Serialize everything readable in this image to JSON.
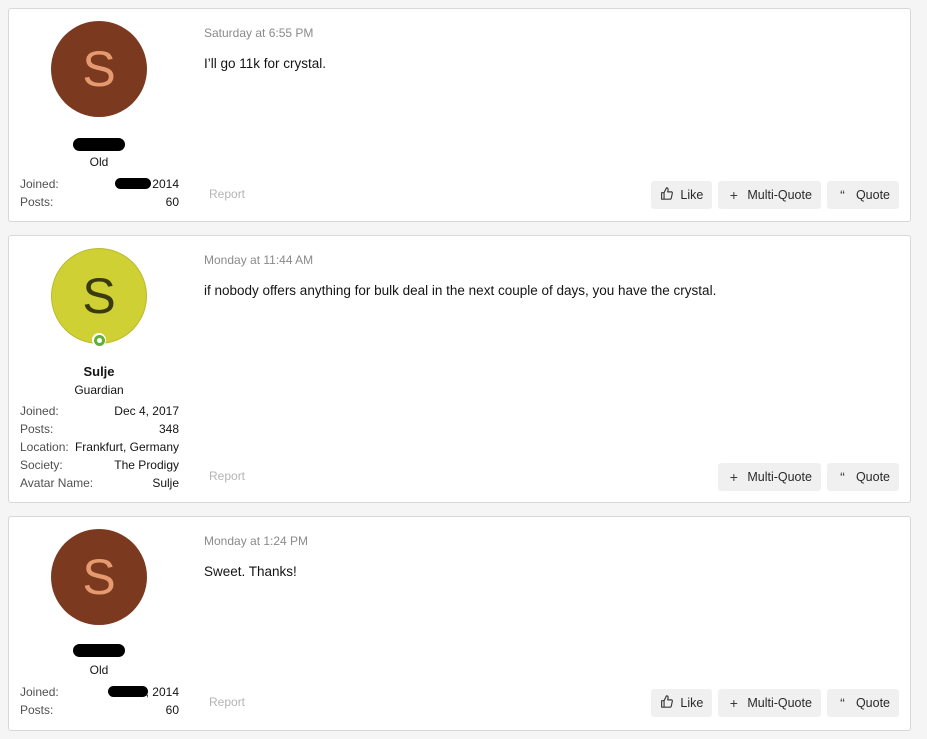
{
  "posts": [
    {
      "avatar_letter": "S",
      "avatar_color": "#7b3a1f",
      "user_title": "Old",
      "joined_label": "Joined:",
      "joined_value": "2014",
      "posts_label": "Posts:",
      "posts_value": "60",
      "timestamp": "Saturday at 6:55 PM",
      "message": "I’ll go 11k for crystal.",
      "report": "Report",
      "like": "Like",
      "multi_quote": "Multi-Quote",
      "quote": "Quote"
    },
    {
      "avatar_letter": "S",
      "avatar_color": "#cfd033",
      "username": "Sulje",
      "user_title": "Guardian",
      "joined_label": "Joined:",
      "joined_value": "Dec 4, 2017",
      "posts_label": "Posts:",
      "posts_value": "348",
      "location_label": "Location:",
      "location_value": "Frankfurt, Germany",
      "society_label": "Society:",
      "society_value": "The Prodigy",
      "avatar_name_label": "Avatar Name:",
      "avatar_name_value": "Sulje",
      "timestamp": "Monday at 11:44 AM",
      "message": "if nobody offers anything for bulk deal in the next couple of days, you have the crystal.",
      "report": "Report",
      "multi_quote": "Multi-Quote",
      "quote": "Quote"
    },
    {
      "avatar_letter": "S",
      "avatar_color": "#7b3a1f",
      "user_title": "Old",
      "joined_label": "Joined:",
      "joined_value": ", 2014",
      "posts_label": "Posts:",
      "posts_value": "60",
      "timestamp": "Monday at 1:24 PM",
      "message": "Sweet. Thanks!",
      "report": "Report",
      "like": "Like",
      "multi_quote": "Multi-Quote",
      "quote": "Quote"
    }
  ],
  "icons": {
    "like": "thumbs-up-icon",
    "multi_quote": "plus-icon",
    "quote": "quote-icon"
  }
}
